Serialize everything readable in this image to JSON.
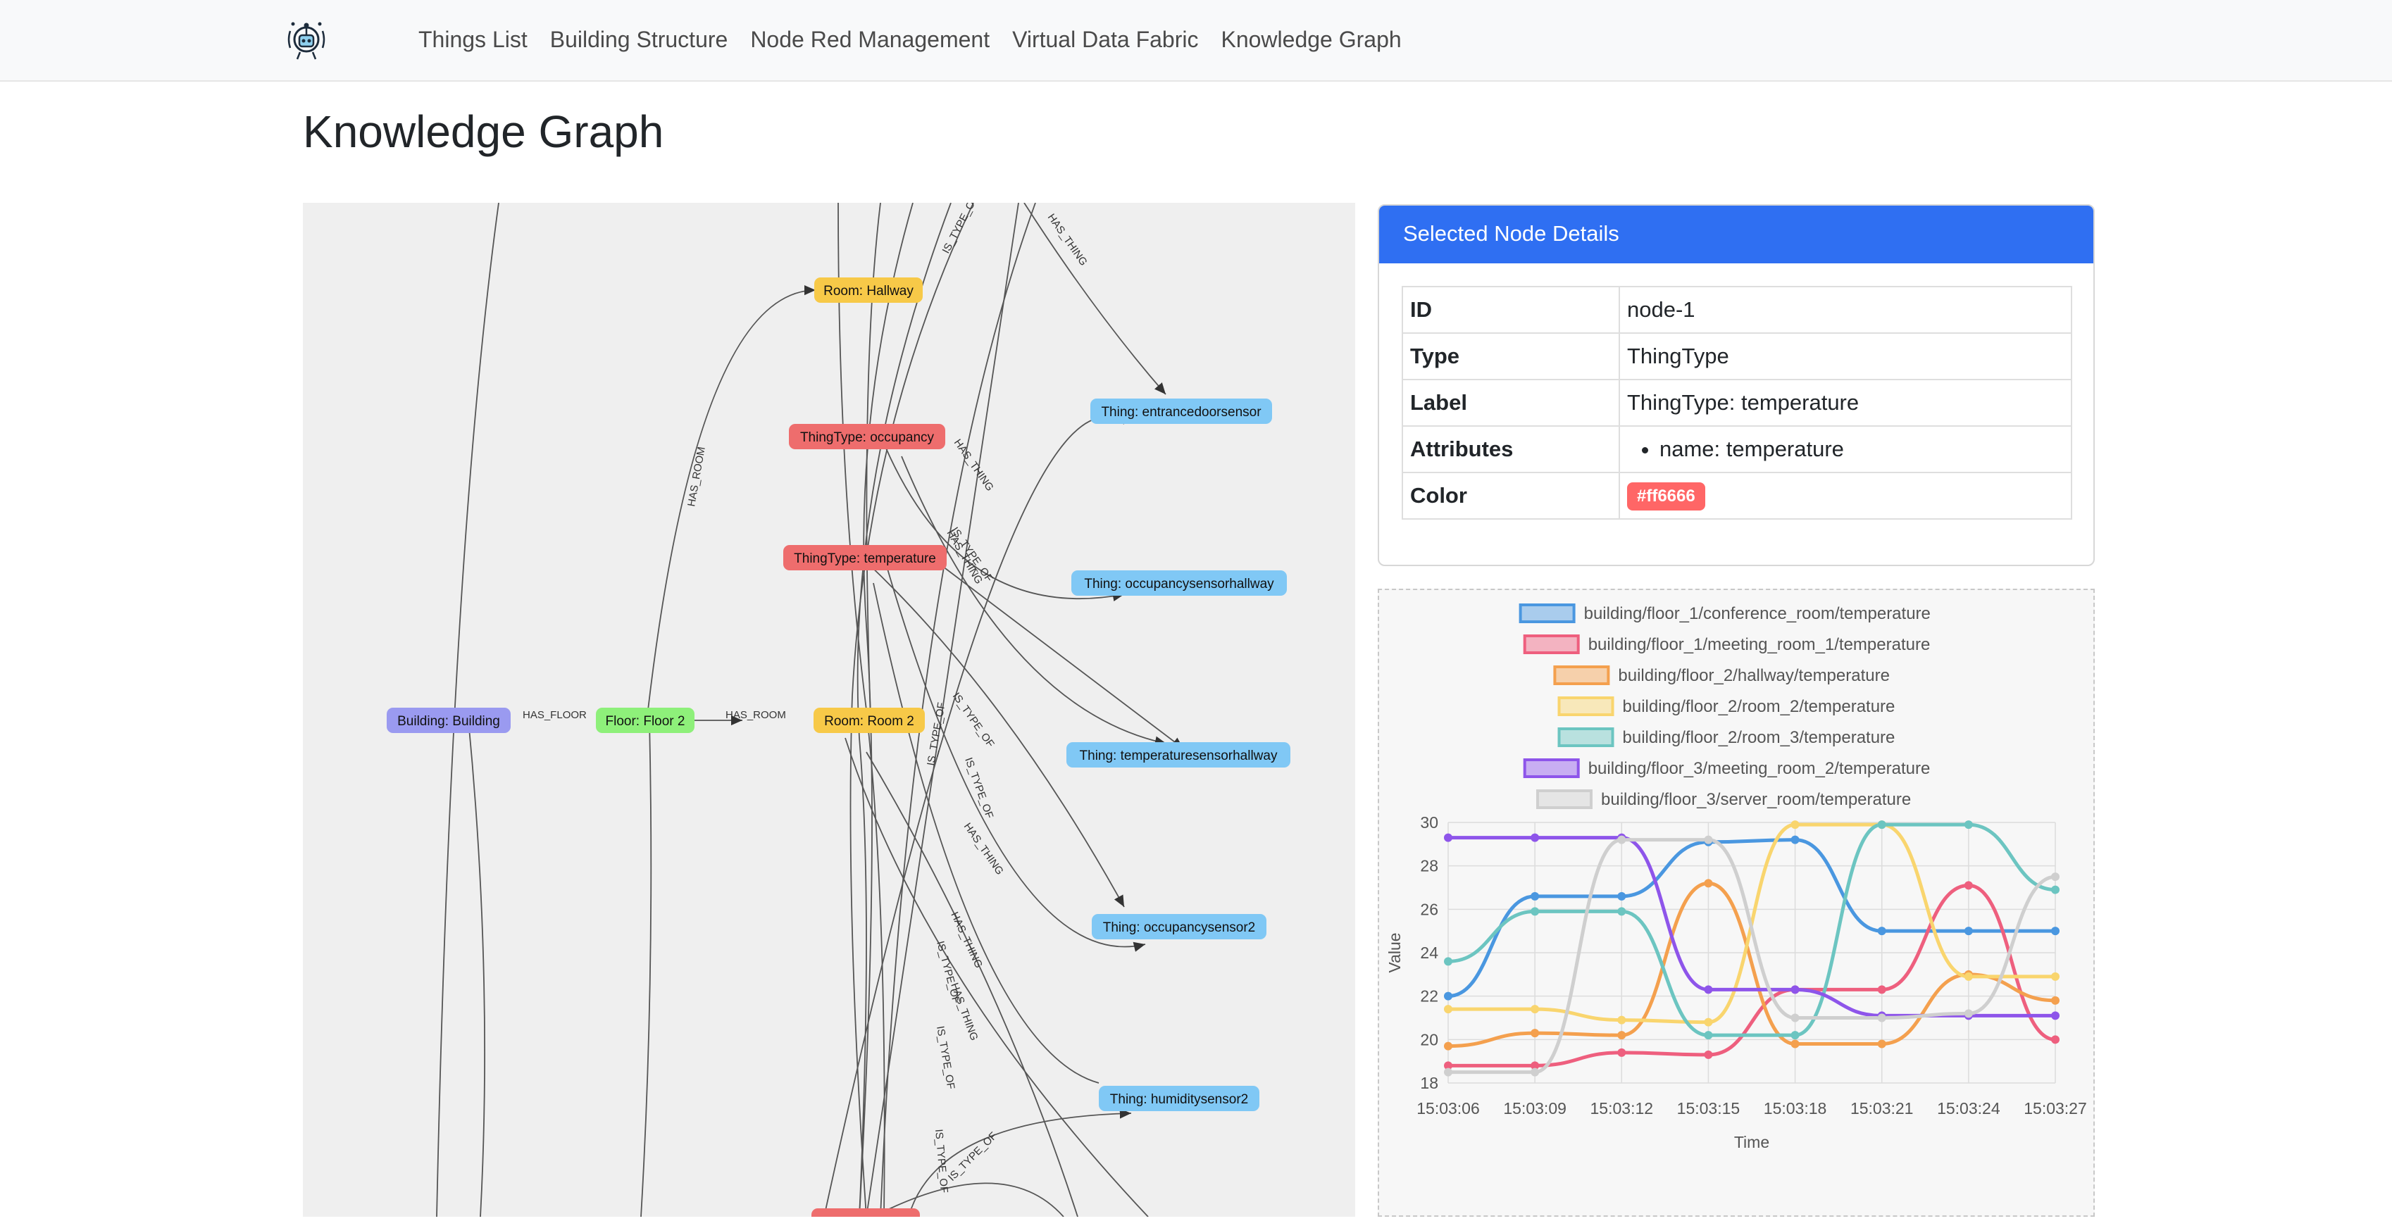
{
  "nav": {
    "links": [
      "Things List",
      "Building Structure",
      "Node Red Management",
      "Virtual Data Fabric",
      "Knowledge Graph"
    ]
  },
  "page": {
    "title": "Knowledge Graph"
  },
  "graph": {
    "nodes": [
      {
        "id": "building",
        "label": "Building: Building",
        "color": "#9a9af0"
      },
      {
        "id": "floor2",
        "label": "Floor: Floor 2",
        "color": "#8ef07a"
      },
      {
        "id": "room2",
        "label": "Room: Room 2",
        "color": "#f7c948"
      },
      {
        "id": "hallway",
        "label": "Room: Hallway",
        "color": "#f7c948"
      },
      {
        "id": "tt_occ",
        "label": "ThingType: occupancy",
        "color": "#ee6d6d"
      },
      {
        "id": "tt_temp",
        "label": "ThingType: temperature",
        "color": "#ee6d6d"
      },
      {
        "id": "t_entr",
        "label": "Thing: entrancedoorsensor",
        "color": "#80c8f5"
      },
      {
        "id": "t_occh",
        "label": "Thing: occupancysensorhallway",
        "color": "#80c8f5"
      },
      {
        "id": "t_temph",
        "label": "Thing: temperaturesensorhallway",
        "color": "#80c8f5"
      },
      {
        "id": "t_occ2",
        "label": "Thing: occupancysensor2",
        "color": "#80c8f5"
      },
      {
        "id": "t_hum2",
        "label": "Thing: humiditysensor2",
        "color": "#80c8f5"
      }
    ],
    "edge_labels": {
      "has_floor": "HAS_FLOOR",
      "has_room": "HAS_ROOM",
      "has_thing": "HAS_THING",
      "is_type_of": "IS_TYPE_OF"
    }
  },
  "details": {
    "header": "Selected Node Details",
    "rows": {
      "id_key": "ID",
      "id_val": "node-1",
      "type_key": "Type",
      "type_val": "ThingType",
      "label_key": "Label",
      "label_val": "ThingType: temperature",
      "attr_key": "Attributes",
      "attr_val": "name: temperature",
      "color_key": "Color",
      "color_val": "#ff6666"
    }
  },
  "chart_data": {
    "type": "line",
    "xlabel": "Time",
    "ylabel": "Value",
    "ylim": [
      18,
      30
    ],
    "yticks": [
      18,
      20,
      22,
      24,
      26,
      28,
      30
    ],
    "grid": true,
    "legend": "top",
    "categories": [
      "15:03:06",
      "15:03:09",
      "15:03:12",
      "15:03:15",
      "15:03:18",
      "15:03:21",
      "15:03:24",
      "15:03:27"
    ],
    "series": [
      {
        "name": "building/floor_1/conference_room/temperature",
        "color": "#4a97e0",
        "values": [
          22.0,
          26.6,
          26.6,
          29.1,
          29.2,
          25.0,
          25.0,
          25.0
        ]
      },
      {
        "name": "building/floor_1/meeting_room_1/temperature",
        "color": "#ee5f7e",
        "values": [
          18.8,
          18.8,
          19.4,
          19.3,
          22.3,
          22.3,
          27.1,
          20.0
        ]
      },
      {
        "name": "building/floor_2/hallway/temperature",
        "color": "#f4a04e",
        "values": [
          19.7,
          20.3,
          20.2,
          27.2,
          19.8,
          19.8,
          23.0,
          21.8
        ]
      },
      {
        "name": "building/floor_2/room_2/temperature",
        "color": "#f9d56e",
        "values": [
          21.4,
          21.4,
          20.9,
          20.8,
          29.9,
          29.9,
          22.9,
          22.9
        ]
      },
      {
        "name": "building/floor_2/room_3/temperature",
        "color": "#6cc5c1",
        "values": [
          23.6,
          25.9,
          25.9,
          20.2,
          20.2,
          29.9,
          29.9,
          26.9
        ]
      },
      {
        "name": "building/floor_3/meeting_room_2/temperature",
        "color": "#8e55ea",
        "values": [
          29.3,
          29.3,
          29.3,
          22.3,
          22.3,
          21.1,
          21.1,
          21.1
        ]
      },
      {
        "name": "building/floor_3/server_room/temperature",
        "color": "#cfcfcf",
        "values": [
          18.5,
          18.5,
          29.2,
          29.2,
          21.0,
          21.0,
          21.2,
          27.5
        ]
      }
    ]
  }
}
